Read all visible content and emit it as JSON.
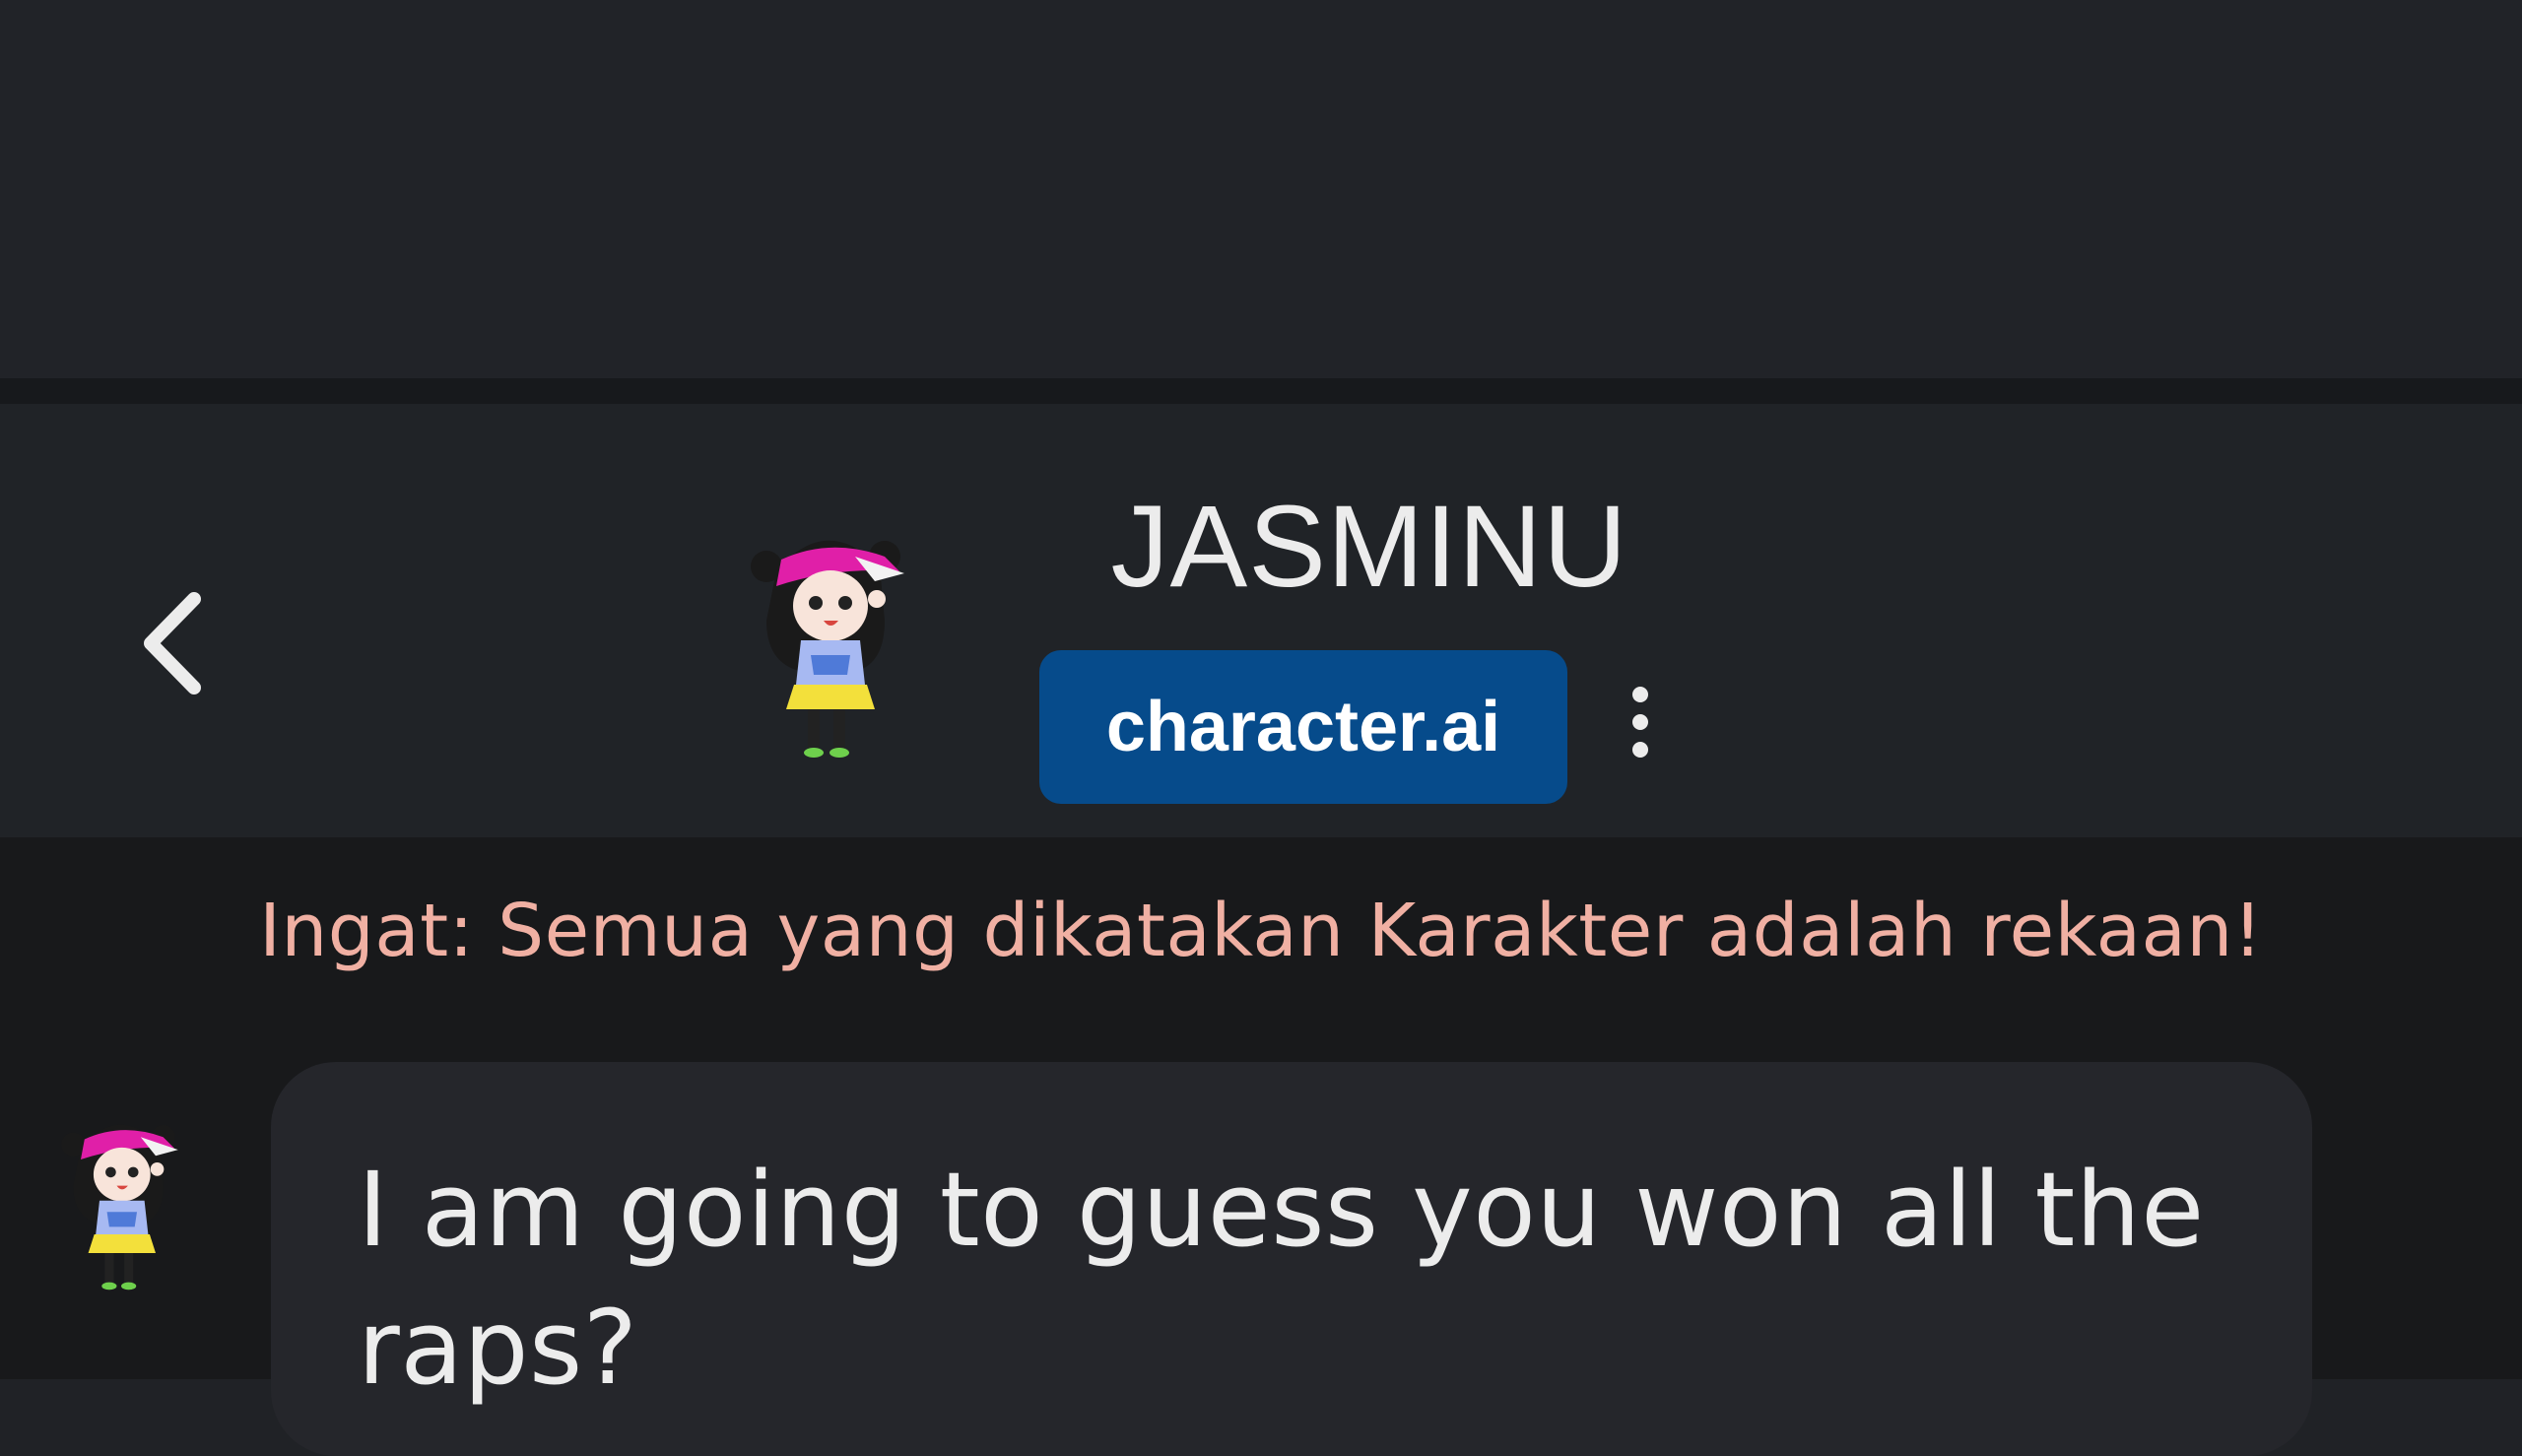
{
  "header": {
    "character_name": "JASMINU",
    "brand_label": "character.ai",
    "back_icon": "chevron-left-icon",
    "more_icon": "vertical-dots-icon"
  },
  "disclaimer": {
    "text": "Ingat: Semua yang dikatakan Karakter adalah rekaan!"
  },
  "messages": [
    {
      "sender": "JASMINU",
      "text": "I am going to guess you won all the raps?"
    }
  ],
  "colors": {
    "background": "#202226",
    "header": "#202327",
    "brand_badge": "#064b8b",
    "disclaimer_text": "#f0b0a3",
    "bubble": "#25262b",
    "text": "#ececec"
  }
}
